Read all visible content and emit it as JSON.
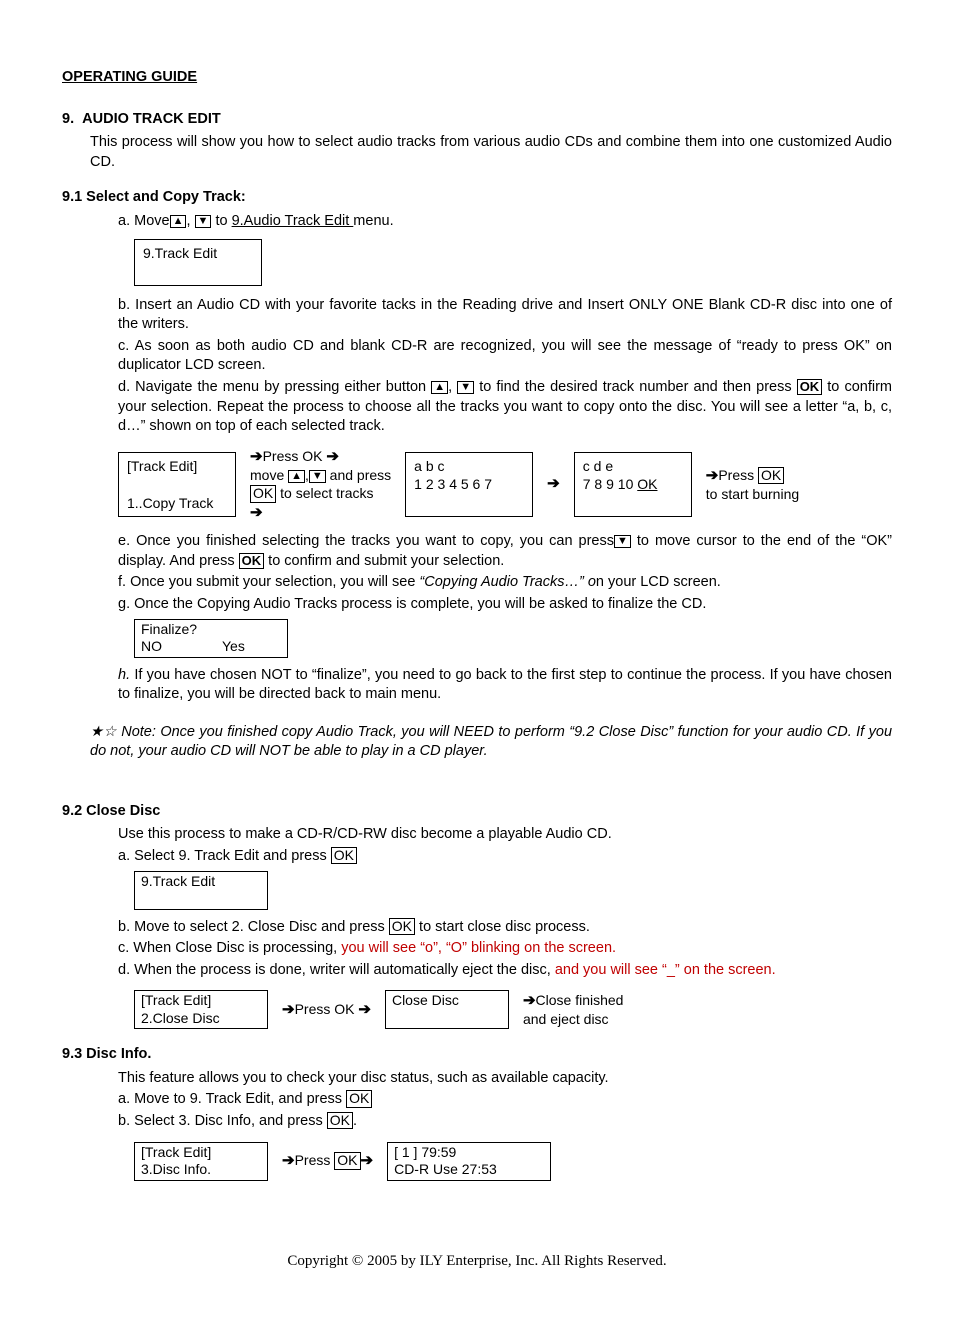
{
  "title": "OPERATING GUIDE",
  "s9": {
    "num": "9.",
    "heading": "AUDIO TRACK EDIT",
    "intro": "This process will show you how to select audio tracks from various audio CDs and combine them into one customized Audio CD."
  },
  "s91": {
    "heading": "9.1 Select and Copy Track:",
    "a_pre": "a. Move",
    "a_mid": ", ",
    "a_post": " to ",
    "a_link": "9.Audio Track Edit ",
    "a_end": "menu.",
    "lcd1": "9.Track Edit",
    "b": "b. Insert an Audio CD with your favorite tacks in the Reading drive and Insert ONLY ONE Blank CD-R disc into one of the writers.",
    "c": "c. As soon as both audio CD and blank CD-R are recognized, you will see the message of “ready to press OK” on duplicator LCD screen.",
    "d_pre": "d. Navigate the menu by pressing either button ",
    "d_mid": ", ",
    "d_post": " to find the desired track number and then press ",
    "d_end": " to confirm your selection. Repeat the process to choose all the tracks you want to copy onto the disc. You will see a letter “a, b, c, d…” shown on top of each selected track.",
    "flow": {
      "box1a": "[Track Edit]",
      "box1b": "1..Copy Track",
      "step2a": "Press OK ",
      "step2b": "move ",
      "step2c": " and press",
      "step2d": " to select tracks",
      "box3a": "a  b     c",
      "box3b": "1 2 3 4 5 6 7",
      "box4a": "c d   e",
      "box4b": "7 8 9 10 ",
      "box4c": "OK",
      "step5a": "Press ",
      "step5b": "to start burning"
    },
    "e_pre": "e. Once you finished selecting the tracks you want to copy, you can press",
    "e_mid": " to move cursor to the end of the “OK” display. And press ",
    "e_end": " to confirm and submit your selection.",
    "f_pre": "f. Once you submit your selection, you will see ",
    "f_it": "“Copying Audio Tracks…” o",
    "f_end": "n your LCD screen.",
    "g": "g. Once the Copying Audio Tracks process is complete, you will be asked to finalize the CD.",
    "g_lcd1": "Finalize?",
    "g_lcd2a": "NO",
    "g_lcd2b": "Yes",
    "h_pre": "h.",
    "h": " If you have chosen NOT to “finalize”, you need to go back to the first step to continue the process. If you have chosen to finalize, you will be directed back to main menu.",
    "note": " Note: Once you finished copy Audio Track, you will NEED to perform “9.2 Close Disc” function for your audio CD.  If you do not, your audio CD will NOT be able to play in a CD player."
  },
  "s92": {
    "heading": "9.2 Close Disc",
    "intro": "Use this process to make a CD-R/CD-RW disc become a playable Audio CD.",
    "a_pre": "a. Select 9. Track Edit and press ",
    "lcd1": "9.Track Edit",
    "b_pre": "b. Move to select 2. Close Disc and press ",
    "b_end": " to start close disc process.",
    "c_pre": "c. When Close Disc is processing, ",
    "c_red": "you will see “o”, “O” blinking on the screen.",
    "d_pre": "d. When the process is done, writer will automatically eject the disc, ",
    "d_red": "and you will see “_” on the screen.",
    "flow": {
      "box1a": "[Track Edit]",
      "box1b": "2.Close Disc",
      "step2": "Press OK ",
      "box3": "Close Disc",
      "step4a": "Close finished",
      "step4b": "and eject disc"
    }
  },
  "s93": {
    "heading": "9.3 Disc Info.",
    "intro": "This feature allows you to check your disc status, such as available capacity.",
    "a_pre": "a. Move to 9. Track Edit, and press ",
    "b_pre": "b.  Select 3. Disc Info, and press ",
    "b_end": ".",
    "flow": {
      "box1a": "[Track Edit]",
      "box1b": "3.Disc Info.",
      "step2": "Press ",
      "box3a": "[ 1 ]        79:59",
      "box3b": "CD-R  Use 27:53"
    }
  },
  "footer": "Copyright © 2005 by ILY Enterprise, Inc. All Rights Reserved."
}
